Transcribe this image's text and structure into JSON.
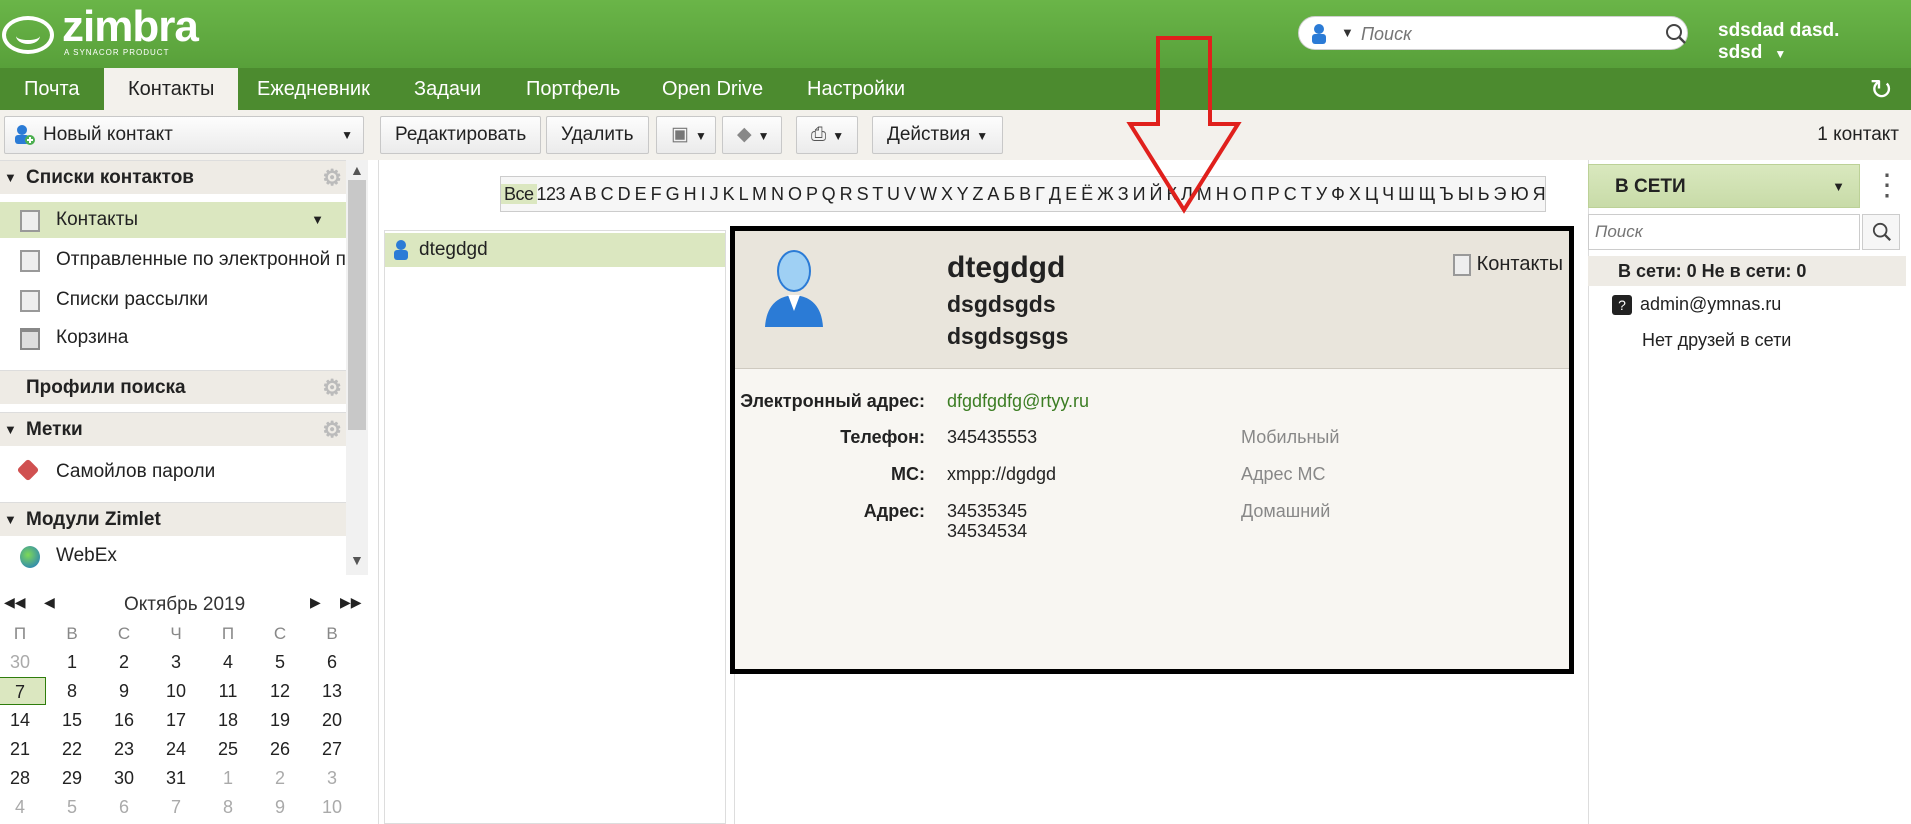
{
  "app": {
    "logo_word": "zimbra",
    "logo_sub": "A SYNACOR PRODUCT",
    "user": "sdsdad dasd. sdsd"
  },
  "search": {
    "placeholder": "Поиск"
  },
  "tabs": [
    "Почта",
    "Контакты",
    "Ежедневник",
    "Задачи",
    "Портфель",
    "Open Drive",
    "Настройки"
  ],
  "toolbar": {
    "new_contact": "Новый контакт",
    "edit": "Редактировать",
    "delete": "Удалить",
    "actions": "Действия",
    "count": "1 контакт"
  },
  "sidebar": {
    "contact_lists_header": "Списки контактов",
    "items": [
      "Контакты",
      "Отправленные по электронной почте",
      "Списки рассылки",
      "Корзина"
    ],
    "search_profiles": "Профили поиска",
    "tags_header": "Метки",
    "tag_item": "Самойлов пароли",
    "zimlets_header": "Модули Zimlet",
    "zimlet_item": "WebEx"
  },
  "calendar": {
    "month": "Октябрь 2019",
    "dow": [
      "П",
      "В",
      "С",
      "Ч",
      "П",
      "С",
      "В"
    ],
    "weeks": [
      [
        "30",
        "1",
        "2",
        "3",
        "4",
        "5",
        "6"
      ],
      [
        "7",
        "8",
        "9",
        "10",
        "11",
        "12",
        "13"
      ],
      [
        "14",
        "15",
        "16",
        "17",
        "18",
        "19",
        "20"
      ],
      [
        "21",
        "22",
        "23",
        "24",
        "25",
        "26",
        "27"
      ],
      [
        "28",
        "29",
        "30",
        "31",
        "1",
        "2",
        "3"
      ],
      [
        "4",
        "5",
        "6",
        "7",
        "8",
        "9",
        "10"
      ]
    ],
    "today": "7"
  },
  "alphabet": {
    "all": "Все",
    "letters": "123 A B C D E F G H I J K L M N O P Q R S T U V W X Y Z А Б В Г Д Е Ё Ж З И Й К Л М Н О П Р С Т У Ф Х Ц Ч Ш Щ Ъ Ы Ь Э Ю Я"
  },
  "list": {
    "item": "dtegdgd"
  },
  "contact": {
    "name1": "dtegdgd",
    "name2": "dsgdsgds",
    "name3": "dsgdsgsgs",
    "folder": "Контакты",
    "email_label": "Электронный адрес:",
    "email": "dfgdfgdfg@rtyy.ru",
    "phone_label": "Телефон:",
    "phone": "345435553",
    "phone_type": "Мобильный",
    "im_label": "МС:",
    "im": "xmpp://dgdgd",
    "im_type": "Адрес МС",
    "addr_label": "Адрес:",
    "addr1": "34535345",
    "addr2": "34534534",
    "addr_type": "Домашний"
  },
  "chat": {
    "presence": "В СЕТИ",
    "search_placeholder": "Поиск",
    "status": "В сети: 0 Не в сети: 0",
    "buddy": "admin@ymnas.ru",
    "no_friends": "Нет друзей в сети"
  },
  "colors": {
    "header_green": "#5fa63f",
    "tab_bar": "#4c8b2f",
    "selection": "#dbe7c0",
    "annotation_red": "#e0201c"
  }
}
